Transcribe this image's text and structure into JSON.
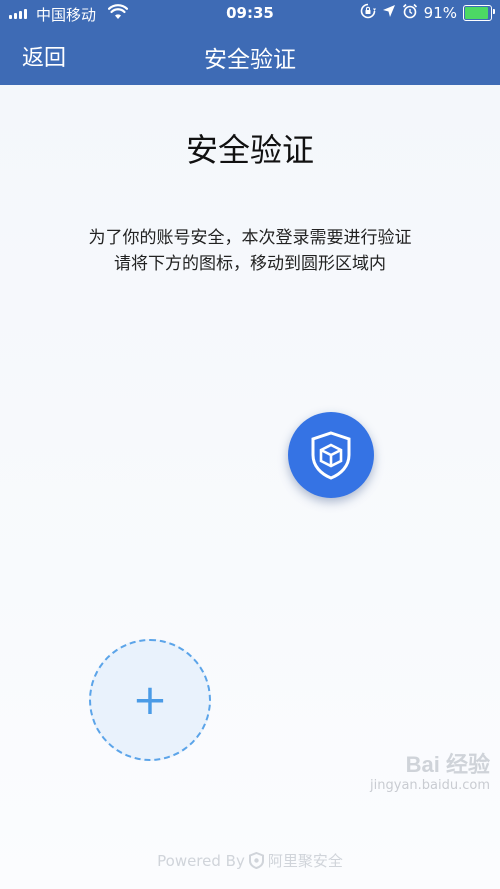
{
  "status_bar": {
    "carrier": "中国移动",
    "time": "09:35",
    "battery_percent": "91%",
    "battery_level": 0.91
  },
  "nav": {
    "back_label": "返回",
    "title": "安全验证"
  },
  "main": {
    "title": "安全验证",
    "instruction_line1": "为了你的账号安全，本次登录需要进行验证",
    "instruction_line2": "请将下方的图标，移动到圆形区域内",
    "drop_zone_symbol": "+"
  },
  "footer": {
    "powered_by": "Powered By",
    "brand": "阿里聚安全"
  },
  "watermark": {
    "logo": "Bai 经验",
    "url": "jingyan.baidu.com"
  },
  "colors": {
    "header": "#3e6bb5",
    "drag_icon": "#3573e4",
    "drop_zone_border": "#5ba4e9"
  },
  "icons": [
    "signal-icon",
    "wifi-icon",
    "lock-rotation-icon",
    "location-icon",
    "alarm-icon",
    "battery-icon",
    "shield-cube-icon",
    "plus-icon",
    "shield-logo-icon"
  ]
}
